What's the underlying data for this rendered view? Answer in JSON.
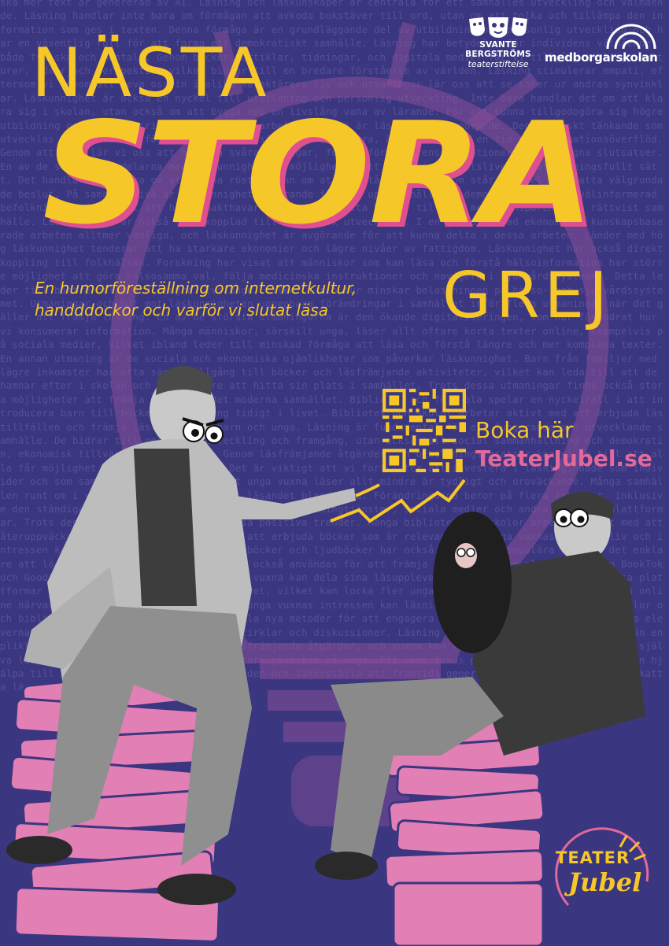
{
  "title": {
    "line1": "NÄSTA",
    "line2": "STORA",
    "line3": "GREJ"
  },
  "tagline": {
    "line1": "En humorföreställning om internetkultur,",
    "line2": "handddockor och varför vi slutat läsa"
  },
  "sponsors": {
    "svante_name": "SVANTE BERGSTRÖMS",
    "svante_sub": "teaterstiftelse",
    "medborgarskolan": "medborgarskolan"
  },
  "booking": {
    "label": "Boka här",
    "site": "TeaterJubel.se"
  },
  "brand_logo": {
    "word1": "TEATER",
    "word2": "Jubel"
  },
  "background_text": "ska mer text är genererad av AI. Läsning och läskunskaper är centrala för ett samhälles utveckling och välmående. Läsning handlar inte bara om förmågan att avkoda bokstäver till ord, utan om att tolka och tillämpa den information som ges i texten. Denna förmåga är en grundläggande del av utbildning och personlig utveckling och har en väsentlig roll för att forma ett demokratiskt samhälle. Läsning har betydelse för individens välmående, både fysiska och mentala. Genom böcker, artiklar, tidningar, och digitala medier får vi tillgång till nya kulturer, idéer och perspektiv, vilket bidrar till en bredare förståelse av världen. Läsning stimulerar empati, eftersom vi genom att leva oss in i olika karaktärers liv och utmaningar lär oss att se saker ur andras synvinklar. Läskunnighet är också en nyckel till utbildning och personlig utveckling. Inte bara handlar det om att klara sig i skolan, utan också om att bygga upp en livslång vana av lärande. För att kunna tillgodogöra sig högre utbildning och framgångsrikt konkurrera på arbetsmarknaden är läsförmågan avgörande. Den kritiskt tänkande som utvecklas när vi läser, förmågan att ifrågasätta och analysera, är oumbärlig i en tid av informationsöverflöd. Genom att läsa lär vi oss att hantera svåra meningar, förstå författarens intentioner och dra egna slutsatser. En av de största fördelarna med läskunnighet är möjligheten att delta i samhällslivet på ett meningsfullt sätt. Det handlar inte bara om att kunna rösta, utan om att förstå de frågor som står på spel och fatta välgrundade beslut. På samhällsnivå är läskunnighet avgörande för att upprätthålla en demokrati. Utan en välinformerad befolkning är det svårt att hålla makthavare ansvariga. Detta bidrar till ett mer transparent och rättvist samhälle. Läskunnighet är också nära kopplad till ekonomisk utveckling. I en globaliserad ekonomi är kunskapsbaserade arbeten alltmer vanliga, och läskunnighet är avgörande för att kunna delta i dessa arbeten. Länder med hög läskunnighet tenderar att ha starkare ekonomier och lägre nivåer av fattigdom. Läskunnighet har också direkt koppling till folkhälsan. Forskning har visat att människor som kan läsa och förstå hälsoinformation har större möjlighet att göra hälsosamma val, följa medicinska instruktioner och navigera i sjukvårdssystemet. Detta leder till bättre hälsa och längre livslängd, vilket i sin tur minskar belastningen på hälso- och sjukvårdssystemet. Utmaningar och hot mot läskunnigheten uppenbara förändringar i samhället inför flera utmaningar när det gäller att främja läsning. En av de största utmaningarna är den ökande digitaliseringen, som har förändrat hur vi konsumerar information. Många människor, särskilt unga, läser allt oftare korta texter online, exempelvis på sociala medier, vilket ibland leder till minskad förmåga att läsa och förstå längre och mer komplexa texter. En annan utmaning är de sociala och ekonomiska ojämlikheter som påverkar läskunnighet. Barn från familjer med lägre inkomster har ofta sämre tillgång till böcker och läsfrämjande aktiviteter, vilket kan leda till att de hamnar efter i skolan och får svårare att hitta sin plats i samhället. Trots dessa utmaningar finns också stora möjligheter att främja läsning i det moderna samhället. Bibliotek och förskola spelar en nyckelroll i att introducera barn till böcker och läsning tidigt i livet. Bibliotek och skolor arbetar aktivt med att erbjuda lästillfällen och främja läslust bland barn och unga. Läsning är fundamental för ett fungerande och utvecklande samhälle. De bidrar till personlig utveckling och framgång, utan också till social sammanhållning och demokratin, ekonomisk tillväxt och folkhälsa. Genom läsfrämjande åtgärder och utbildningsinsatser kan vi se till att alla får möjlighet att delta och bidra. Det är viktigt att vi fortsätter att investera i läsning, både som individer och som samhälle. Problemet med att unga vuxna läser allt mindre är tydligt och oroväckande. Många samhällen runt om i världen ser en minskning i läsandet bland unga. Förändringarna beror på flera faktorer, inklusive den ständiga tillgången till digitala medier, streamingtjänster, sociala medier och andra digitala plattformar. Trots denna utveckling finns det också positiva trender. Många bibliotek och skolor arbetar aktivt med att återuppväcka läslusten bland unga. Genom att erbjuda böcker som är relevanta för unga vuxnas dagliga liv och intressen kan man öka deras engagemang. E-böcker och ljudböcker har också blivit mer populära och gör det enklare att läsa på språng. Sociala medier kan också användas för att främja läsning, genom plattformar som BookTok och Goodreads eller Bookstagram, där unga vuxna kan dela sina läsupplevelser och hitta inspiration. Dessa plattformar gör läsning till en social aktivitet, vilket kan locka fler unga att läsa. Genom att integrera en online närvaro och anpassa litteraturen till unga vuxnas intressen kan läsningen av nytt hitta sin plats. Skolor och bibliotek behöver fortsätta att utveckla nya metoder för att engagera elever. Exempelvis genom att låta eleverna välja litteratur själva, ordna bokcirklar och diskussioner. Läsning måste ses som ett nöje snarare än en plikt. Det är viktigt att investera i läsfrämjande åtgärder, och vuxna kan vara goda förebilder genom att själva läsa ofta populärkultur, som har en stark påverkan på unga. Ett ökat fokus på läsning och litteratur kan hjälpa till att motverka den nuvarande trenden och säkerställa att framtida generationer fortsätter att uppskatta läsning och dess många fördelar."
}
